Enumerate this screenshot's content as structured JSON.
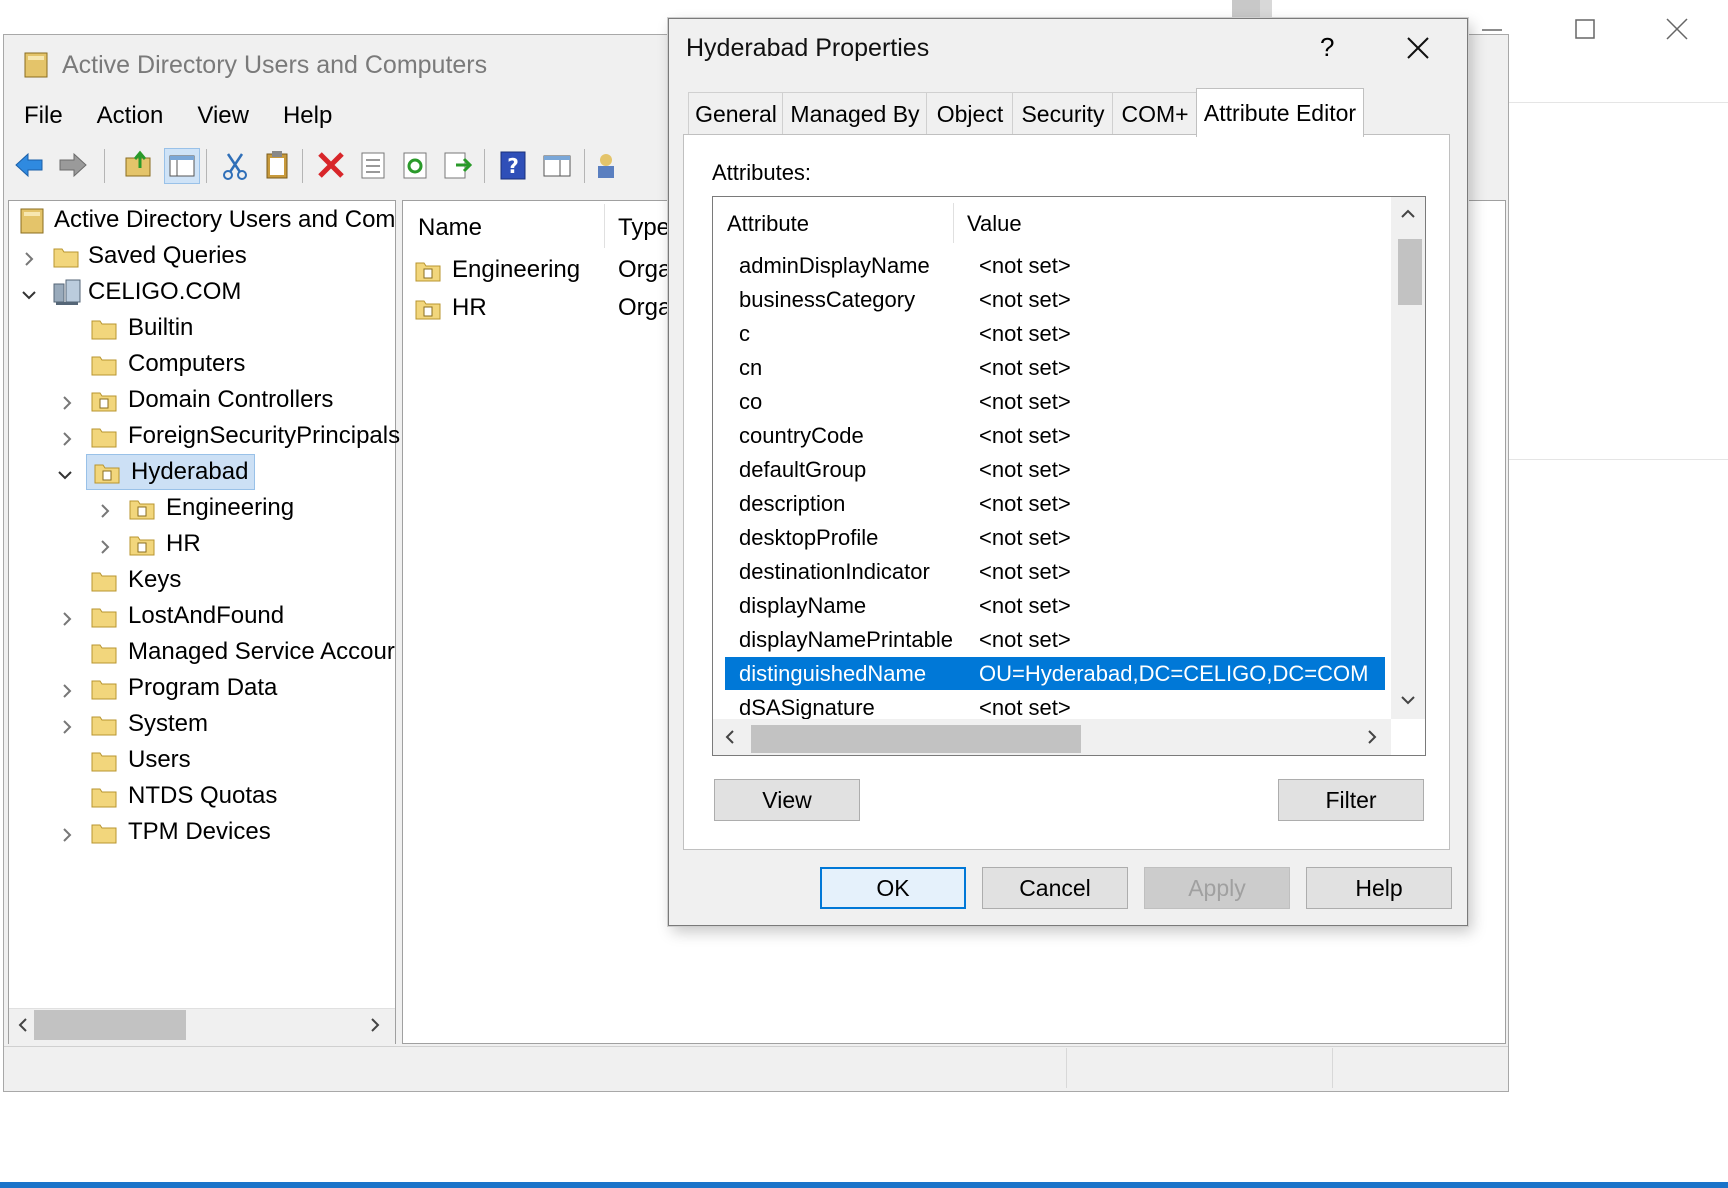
{
  "main_window": {
    "title": "Active Directory Users and Computers",
    "menu": [
      "File",
      "Action",
      "View",
      "Help"
    ],
    "tree": {
      "root": "Active Directory Users and Com",
      "items": [
        {
          "label": "Saved Queries"
        },
        {
          "label": "CELIGO.COM"
        },
        {
          "label": "Builtin"
        },
        {
          "label": "Computers"
        },
        {
          "label": "Domain Controllers"
        },
        {
          "label": "ForeignSecurityPrincipals"
        },
        {
          "label": "Hyderabad"
        },
        {
          "label": "Engineering"
        },
        {
          "label": "HR"
        },
        {
          "label": "Keys"
        },
        {
          "label": "LostAndFound"
        },
        {
          "label": "Managed Service Accour"
        },
        {
          "label": "Program Data"
        },
        {
          "label": "System"
        },
        {
          "label": "Users"
        },
        {
          "label": "NTDS Quotas"
        },
        {
          "label": "TPM Devices"
        }
      ]
    },
    "list": {
      "columns": [
        "Name",
        "Type"
      ],
      "rows": [
        {
          "name": "Engineering",
          "type": "Orga"
        },
        {
          "name": "HR",
          "type": "Orga"
        }
      ]
    }
  },
  "dialog": {
    "title": "Hyderabad Properties",
    "help_glyph": "?",
    "tabs": [
      "General",
      "Managed By",
      "Object",
      "Security",
      "COM+",
      "Attribute Editor"
    ],
    "active_tab": "Attribute Editor",
    "attributes_label": "Attributes:",
    "columns": [
      "Attribute",
      "Value"
    ],
    "rows": [
      {
        "attr": "adminDisplayName",
        "value": "<not set>"
      },
      {
        "attr": "businessCategory",
        "value": "<not set>"
      },
      {
        "attr": "c",
        "value": "<not set>"
      },
      {
        "attr": "cn",
        "value": "<not set>"
      },
      {
        "attr": "co",
        "value": "<not set>"
      },
      {
        "attr": "countryCode",
        "value": "<not set>"
      },
      {
        "attr": "defaultGroup",
        "value": "<not set>"
      },
      {
        "attr": "description",
        "value": "<not set>"
      },
      {
        "attr": "desktopProfile",
        "value": "<not set>"
      },
      {
        "attr": "destinationIndicator",
        "value": "<not set>"
      },
      {
        "attr": "displayName",
        "value": "<not set>"
      },
      {
        "attr": "displayNamePrintable",
        "value": "<not set>"
      },
      {
        "attr": "distinguishedName",
        "value": "OU=Hyderabad,DC=CELIGO,DC=COM"
      },
      {
        "attr": "dSASignature",
        "value": "<not set>"
      }
    ],
    "selected_attribute": "distinguishedName",
    "buttons": {
      "view": "View",
      "filter": "Filter",
      "ok": "OK",
      "cancel": "Cancel",
      "apply": "Apply",
      "help": "Help"
    }
  },
  "colors": {
    "selection": "#0078d7",
    "tree_selection": "#cce0f5",
    "taskbar_line": "#1a73c9"
  }
}
